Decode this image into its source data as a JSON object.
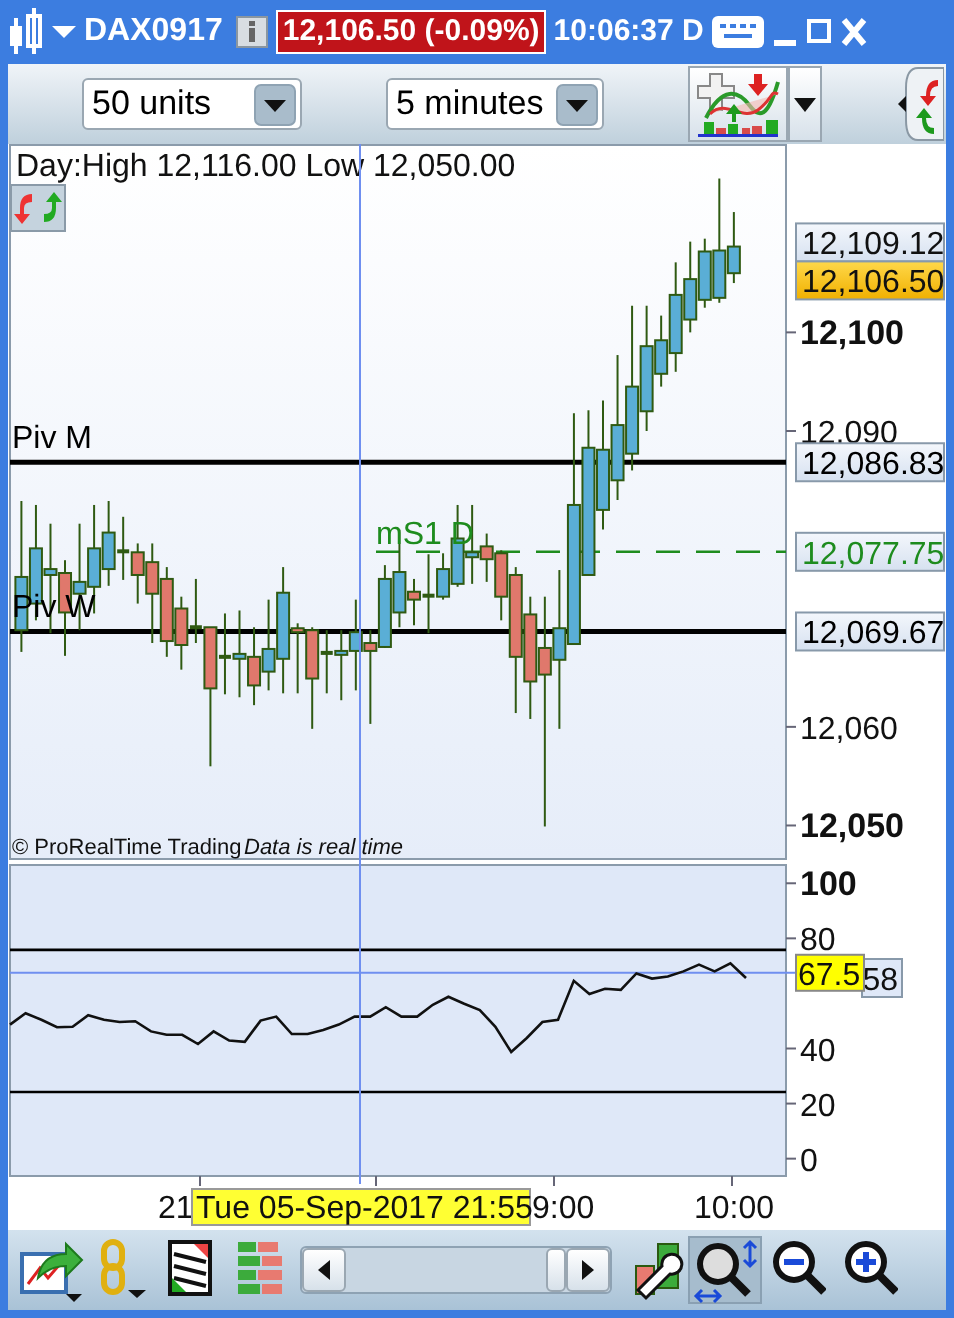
{
  "window": {
    "title": "DAX0917",
    "price": "12,106.50 (-0.09%)",
    "time": "10:06:37 D"
  },
  "toolbar": {
    "units": "50 units",
    "interval": "5 minutes"
  },
  "price_chart": {
    "header": "Day:High 12,116.00 Low 12,050.00",
    "copyright": "© ProRealTime Trading",
    "status": "Data is real time",
    "lines": [
      {
        "label": "Piv M",
        "value": "12,086.83",
        "kind": "solid",
        "color": "#000000"
      },
      {
        "label": "mS1 D",
        "value": "12,077.75",
        "kind": "dashed",
        "color": "#1e8c1e"
      },
      {
        "label": "Piv W",
        "value": "12,069.67",
        "kind": "solid",
        "color": "#000000"
      }
    ],
    "price_tags": [
      {
        "text": "12,109.12",
        "kind": "level"
      },
      {
        "text": "12,106.50",
        "kind": "current"
      }
    ],
    "chart_data": {
      "type": "candlestick",
      "ylim": [
        12046.5,
        12119.1
      ],
      "yticks": [
        {
          "value": 12100,
          "label": "12,100"
        },
        {
          "value": 12090,
          "label": "12,090"
        },
        {
          "value": 12060,
          "label": "12,060"
        },
        {
          "value": 12050,
          "label": "12,050"
        }
      ],
      "ohlc": [
        [
          12069.8,
          12082.9,
          12067.6,
          12075.2
        ],
        [
          12072.5,
          12082.5,
          12070.8,
          12078.1
        ],
        [
          12075.4,
          12080.6,
          12069.5,
          12076.0
        ],
        [
          12075.6,
          12076.9,
          12067.2,
          12071.6
        ],
        [
          12073.5,
          12080.6,
          12069.8,
          12074.7
        ],
        [
          12074.2,
          12082.5,
          12071.5,
          12078.1
        ],
        [
          12076.0,
          12082.9,
          12074.3,
          12079.7
        ],
        [
          12077.8,
          12081.3,
          12074.9,
          12077.6
        ],
        [
          12077.7,
          12078.6,
          12072.5,
          12075.4
        ],
        [
          12076.7,
          12078.6,
          12068.5,
          12073.5
        ],
        [
          12075.0,
          12076.2,
          12067.1,
          12068.7
        ],
        [
          12072.0,
          12073.2,
          12065.8,
          12068.3
        ],
        [
          12070.1,
          12075.0,
          12068.5,
          12069.8
        ],
        [
          12070.1,
          12070.1,
          12056.0,
          12063.9
        ],
        [
          12067.1,
          12071.5,
          12063.3,
          12066.9
        ],
        [
          12066.9,
          12071.8,
          12063.0,
          12067.4
        ],
        [
          12067.1,
          12070.1,
          12062.2,
          12064.2
        ],
        [
          12065.6,
          12072.9,
          12063.7,
          12067.9
        ],
        [
          12066.9,
          12076.2,
          12063.4,
          12073.6
        ],
        [
          12070.0,
          12070.5,
          12063.4,
          12069.6
        ],
        [
          12069.8,
          12070.1,
          12059.8,
          12064.9
        ],
        [
          12067.5,
          12069.8,
          12063.4,
          12067.3
        ],
        [
          12067.3,
          12069.8,
          12062.7,
          12067.7
        ],
        [
          12067.7,
          12072.9,
          12063.7,
          12069.6
        ],
        [
          12068.5,
          12069.8,
          12060.3,
          12067.7
        ],
        [
          12068.1,
          12076.4,
          12068.0,
          12075.0
        ],
        [
          12071.6,
          12080.0,
          12070.1,
          12075.7
        ],
        [
          12073.7,
          12075.0,
          12070.3,
          12072.9
        ],
        [
          12073.3,
          12077.5,
          12069.5,
          12073.1
        ],
        [
          12073.2,
          12077.6,
          12072.9,
          12076.0
        ],
        [
          12074.5,
          12082.5,
          12074.2,
          12079.1
        ],
        [
          12077.2,
          12082.5,
          12074.5,
          12077.7
        ],
        [
          12078.3,
          12079.6,
          12074.7,
          12077.0
        ],
        [
          12077.6,
          12077.9,
          12070.8,
          12073.2
        ],
        [
          12075.4,
          12076.2,
          12061.4,
          12067.1
        ],
        [
          12071.4,
          12073.2,
          12060.8,
          12064.6
        ],
        [
          12068.0,
          12073.2,
          12049.9,
          12065.3
        ],
        [
          12066.8,
          12075.9,
          12059.8,
          12070.0
        ],
        [
          12068.4,
          12091.8,
          12068.4,
          12082.5
        ],
        [
          12075.4,
          12092.1,
          12075.4,
          12088.3
        ],
        [
          12082.0,
          12093.1,
          12080.0,
          12088.1
        ],
        [
          12085.0,
          12097.7,
          12083.0,
          12090.6
        ],
        [
          12087.7,
          12102.7,
          12086.0,
          12094.5
        ],
        [
          12092.0,
          12102.7,
          12090.0,
          12098.6
        ],
        [
          12095.8,
          12101.7,
          12094.5,
          12099.2
        ],
        [
          12097.9,
          12107.1,
          12096.0,
          12103.8
        ],
        [
          12101.3,
          12109.2,
          12100.0,
          12105.4
        ],
        [
          12103.3,
          12109.5,
          12102.5,
          12108.2
        ],
        [
          12103.5,
          12115.6,
          12103.0,
          12108.3
        ],
        [
          12106.0,
          12112.2,
          12105.0,
          12108.7
        ]
      ]
    }
  },
  "indicator": {
    "tags": [
      {
        "text": "58",
        "kind": "last"
      }
    ],
    "chart_data": {
      "type": "line",
      "ylim": [
        -6.3,
        107
      ],
      "yticks": [
        {
          "value": 0,
          "label": "0"
        },
        {
          "value": 20,
          "label": "20"
        },
        {
          "value": 40,
          "label": "40"
        },
        {
          "value": 80,
          "label": "80"
        },
        {
          "value": 100,
          "label": "100"
        }
      ],
      "ref_lines": [
        {
          "axis": "y",
          "value": 75.8,
          "color": "#000000"
        },
        {
          "axis": "y",
          "value": 24.2,
          "color": "#000000"
        },
        {
          "axis": "y",
          "value": 67.5,
          "color": "#6f8ff0",
          "label": "67.5"
        }
      ],
      "series": [
        {
          "color": "#111111",
          "values": [
            48.7,
            52.8,
            50.4,
            47.7,
            47.9,
            52.1,
            50.4,
            49.6,
            49.9,
            46.2,
            45.0,
            45.0,
            41.6,
            46.2,
            42.9,
            42.4,
            50.1,
            51.6,
            45.3,
            45.3,
            46.7,
            48.7,
            51.6,
            51.6,
            55.0,
            51.6,
            51.6,
            55.9,
            58.8,
            56.2,
            54.0,
            47.9,
            38.7,
            43.8,
            49.6,
            50.4,
            64.6,
            59.8,
            61.7,
            61.3,
            67.3,
            65.4,
            66.1,
            68.0,
            70.5,
            68.0,
            70.9,
            65.6
          ]
        }
      ]
    }
  },
  "time_axis": {
    "labels": [
      "21",
      "9:00",
      "10:00"
    ],
    "cursor_label": "Tue 05-Sep-2017 21:55"
  },
  "bottom_toolbar": [
    {
      "kind": "export",
      "selected": false
    },
    {
      "kind": "link",
      "selected": false
    },
    {
      "kind": "list",
      "selected": false
    },
    {
      "kind": "bars",
      "selected": false
    },
    {
      "kind": "scrollbar"
    },
    {
      "kind": "settings",
      "selected": false
    },
    {
      "kind": "zoom",
      "selected": true
    },
    {
      "kind": "zoom_out",
      "selected": false
    },
    {
      "kind": "zoom_in",
      "selected": false
    }
  ]
}
